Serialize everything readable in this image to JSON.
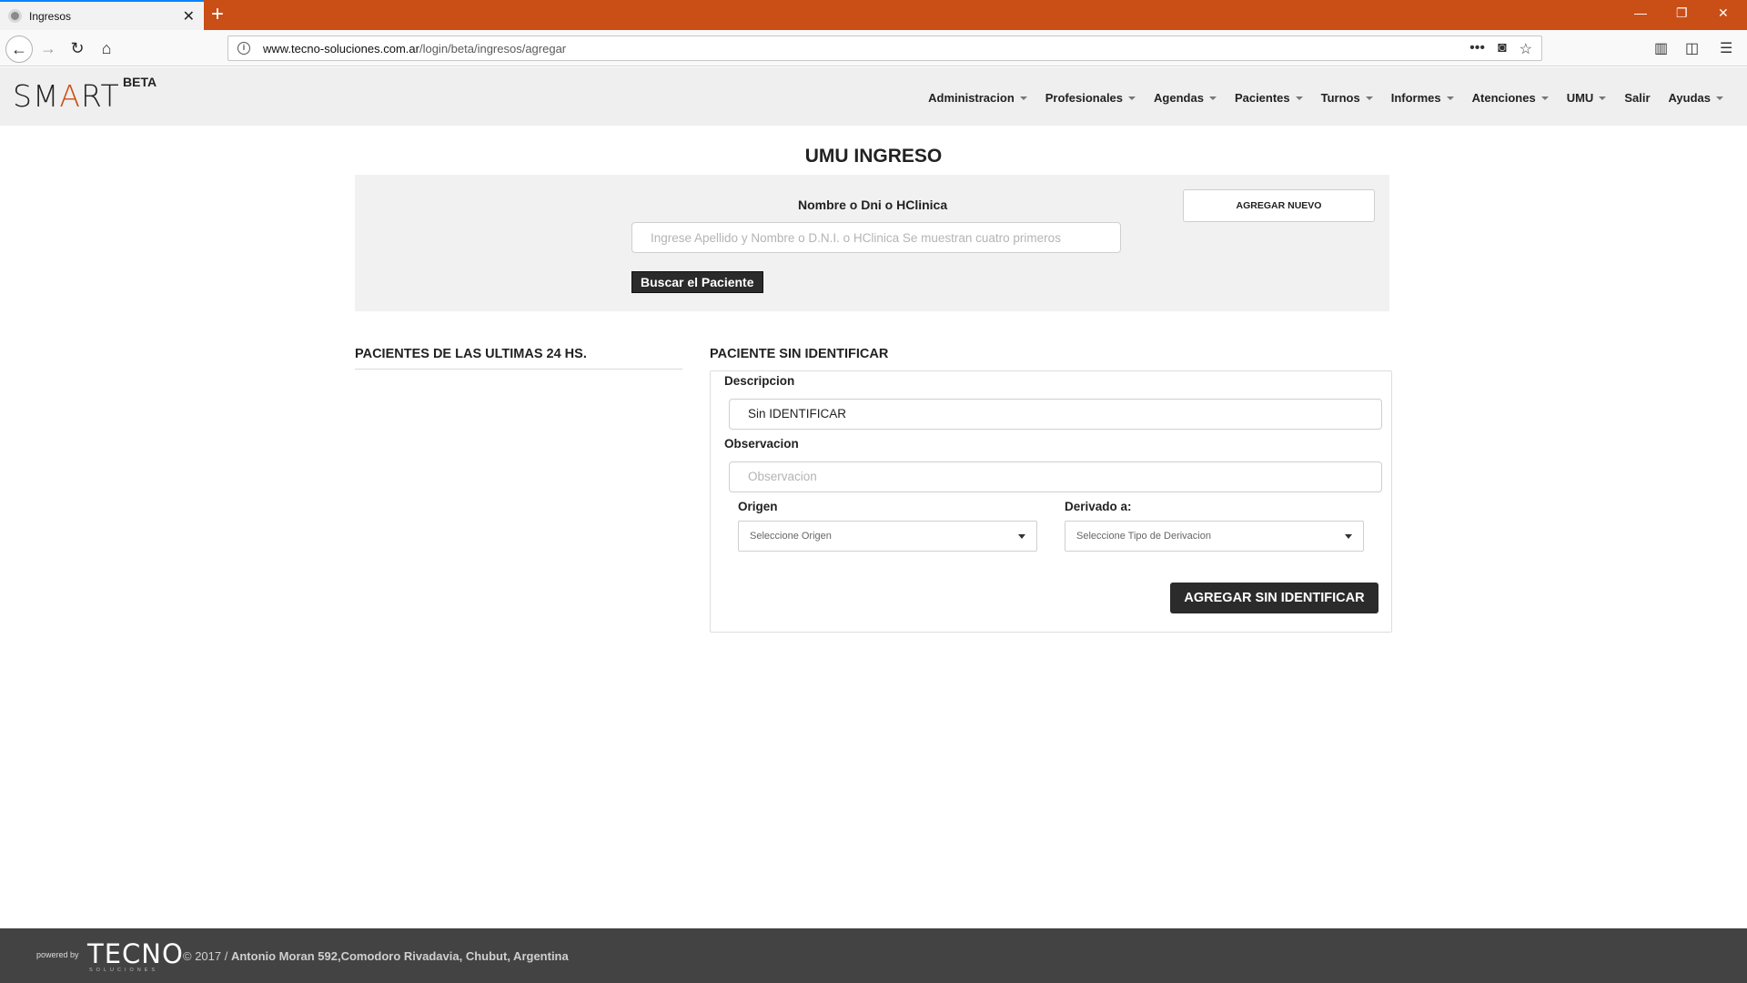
{
  "browser": {
    "tab_title": "Ingresos",
    "new_tab_icon": "+",
    "url_domain": "www.tecno-soluciones.com.ar",
    "url_path": "/login/beta/ingresos/agregar"
  },
  "header": {
    "logo": "SMART",
    "badge": "BETA",
    "menu": [
      {
        "label": "Administracion"
      },
      {
        "label": "Profesionales"
      },
      {
        "label": "Agendas"
      },
      {
        "label": "Pacientes"
      },
      {
        "label": "Turnos"
      },
      {
        "label": "Informes"
      },
      {
        "label": "Atenciones"
      },
      {
        "label": "UMU"
      },
      {
        "label": "Salir"
      },
      {
        "label": "Ayudas"
      }
    ]
  },
  "main": {
    "title": "UMU INGRESO",
    "search": {
      "label": "Nombre o Dni o HClinica",
      "placeholder": "Ingrese Apellido y Nombre o D.N.I. o HClinica Se muestran cuatro primeros",
      "button": "Buscar el Paciente",
      "add_new": "AGREGAR NUEVO"
    },
    "recent": {
      "title": "PACIENTES DE LAS ULTIMAS 24 HS."
    },
    "unidentified": {
      "title": "PACIENTE SIN IDENTIFICAR",
      "descripcion_label": "Descripcion",
      "descripcion_value": "Sin IDENTIFICAR",
      "observacion_label": "Observacion",
      "observacion_placeholder": "Observacion",
      "origen_label": "Origen",
      "origen_value": "Seleccione Origen",
      "derivado_label": "Derivado a:",
      "derivado_value": "Seleccione Tipo de Derivacion",
      "submit": "AGREGAR SIN IDENTIFICAR"
    }
  },
  "footer": {
    "powered": "powered by",
    "brand": "TECNO",
    "brand_sub": "SOLUCIONES",
    "copyright": "© 2017 /",
    "address": "Antonio Moran 592,Comodoro Rivadavia, Chubut, Argentina"
  }
}
